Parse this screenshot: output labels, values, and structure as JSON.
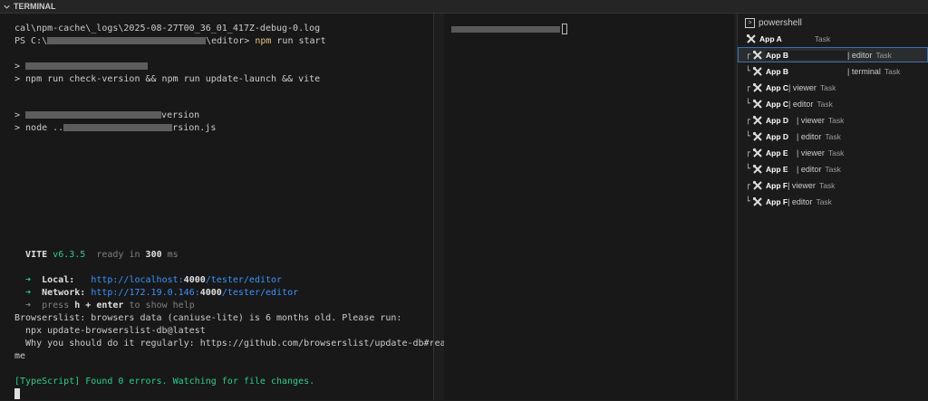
{
  "header": {
    "title": "TERMINAL"
  },
  "left": {
    "lines": [
      {
        "text": "cal\\npm-cache\\_logs\\2025-08-27T00_36_01_417Z-debug-0.log"
      },
      {
        "prompt": "PS C:\\",
        "blur_after_prompt": true,
        "path": "\\editor>",
        "cmd": "npm",
        "args": " run start"
      },
      {
        "prefix": "> ",
        "blurred": true
      },
      {
        "text": "> npm run check-version && npm run update-launch && vite"
      },
      {
        "prefix": "> ",
        "blurred": true,
        "tail": "version"
      },
      {
        "prefix": "> node ..",
        "blurred": true,
        "tail": "rsion.js"
      }
    ],
    "vite": {
      "name": "VITE",
      "version": "v6.3.5",
      "ready": "ready in",
      "ms": "300",
      "ms_unit": "ms"
    },
    "local": {
      "arrow": "➜",
      "label": "Local:",
      "url_prefix": "http://localhost:",
      "port": "4000",
      "url_suffix": "/tester/editor"
    },
    "network": {
      "arrow": "➜",
      "label": "Network:",
      "url_prefix": "http://172.19.0.146:",
      "port": "4000",
      "url_suffix": "/tester/editor"
    },
    "help": {
      "arrow": "➜",
      "pre": "press",
      "key": "h + enter",
      "post": "to show help"
    },
    "browserslist": [
      "Browserslist: browsers data (caniuse-lite) is 6 months old. Please run:",
      "  npx update-browserslist-db@latest",
      "  Why you should do it regularly: https://github.com/browserslist/update-db#read",
      "me"
    ],
    "typescript": "[TypeScript] Found 0 errors. Watching for file changes."
  },
  "tasks": {
    "shell": "powershell",
    "items": [
      {
        "tree": "",
        "app": "App A",
        "suffix": "",
        "task": "Task"
      },
      {
        "tree": "┌",
        "app": "App B",
        "suffix": "| editor",
        "task": "Task",
        "active": true
      },
      {
        "tree": "└",
        "app": "App B",
        "suffix": "| terminal",
        "task": "Task"
      },
      {
        "tree": "┌",
        "app": "App C",
        "suffix": "| viewer",
        "task": "Task"
      },
      {
        "tree": "└",
        "app": "App C",
        "suffix": "| editor",
        "task": "Task"
      },
      {
        "tree": "┌",
        "app": "App D",
        "suffix": "| viewer",
        "task": "Task"
      },
      {
        "tree": "└",
        "app": "App D",
        "suffix": "| editor",
        "task": "Task"
      },
      {
        "tree": "┌",
        "app": "App E",
        "suffix": "| viewer",
        "task": "Task"
      },
      {
        "tree": "└",
        "app": "App E",
        "suffix": "| editor",
        "task": "Task"
      },
      {
        "tree": "┌",
        "app": "App F",
        "suffix": "| viewer",
        "task": "Task"
      },
      {
        "tree": "└",
        "app": "App F",
        "suffix": "| editor",
        "task": "Task"
      }
    ]
  }
}
